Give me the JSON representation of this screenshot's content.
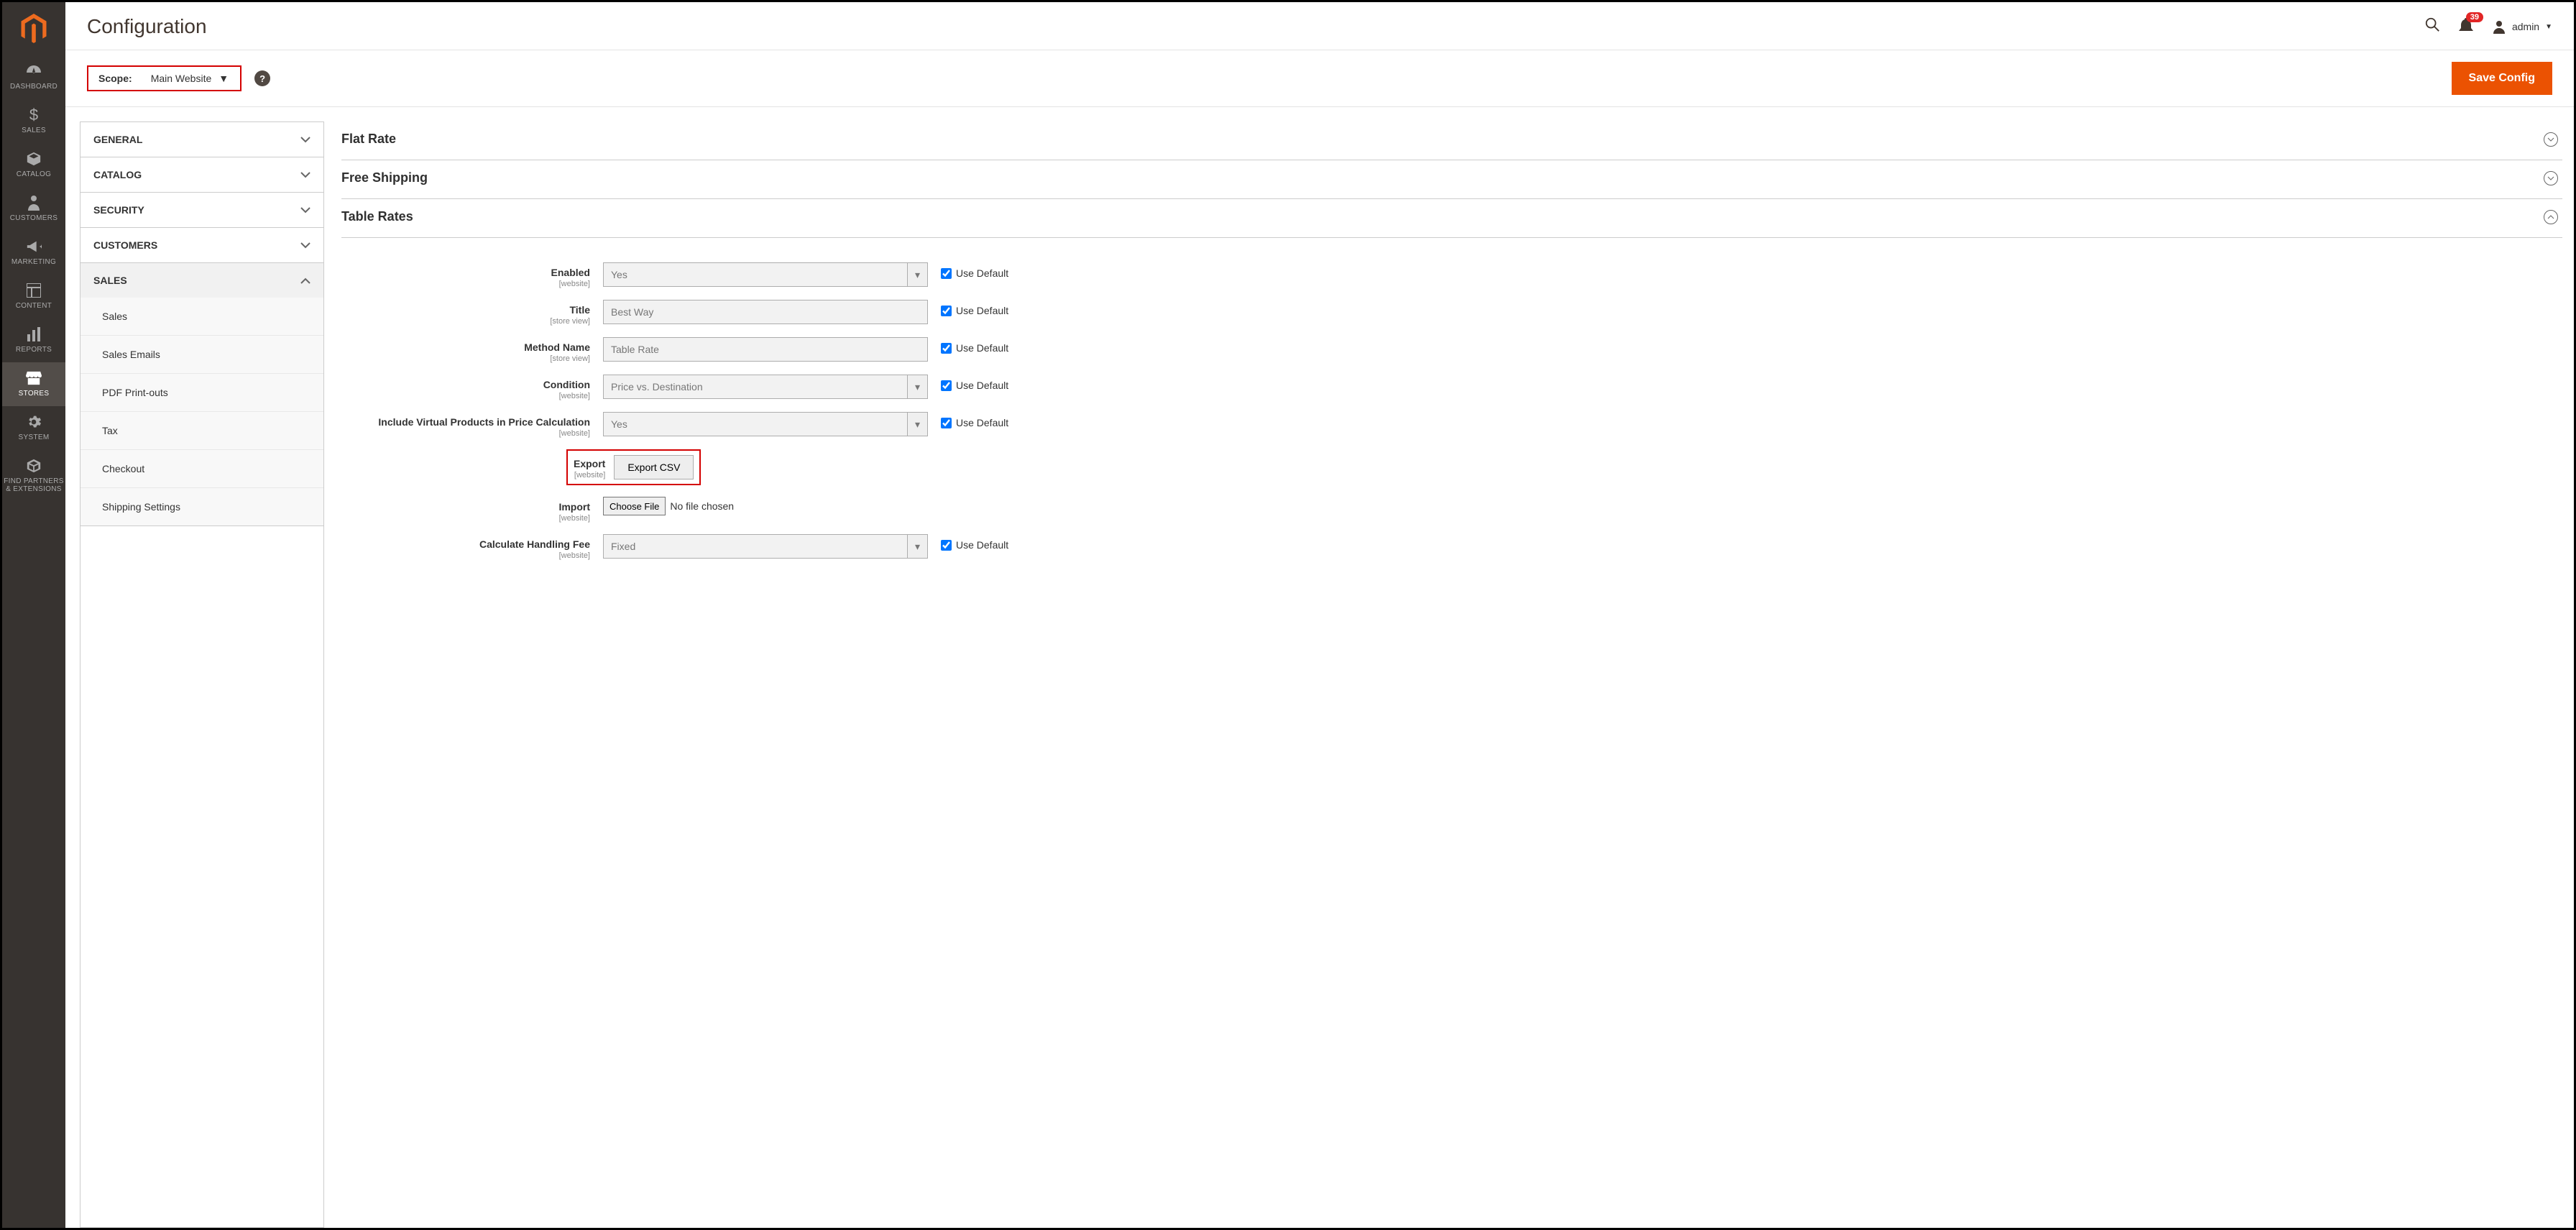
{
  "sidebar": {
    "items": [
      {
        "label": "DASHBOARD"
      },
      {
        "label": "SALES"
      },
      {
        "label": "CATALOG"
      },
      {
        "label": "CUSTOMERS"
      },
      {
        "label": "MARKETING"
      },
      {
        "label": "CONTENT"
      },
      {
        "label": "REPORTS"
      },
      {
        "label": "STORES"
      },
      {
        "label": "SYSTEM"
      },
      {
        "label": "FIND PARTNERS & EXTENSIONS"
      }
    ]
  },
  "header": {
    "title": "Configuration",
    "notif_count": "39",
    "user_name": "admin"
  },
  "toolbar": {
    "scope_label": "Scope:",
    "scope_value": "Main Website",
    "save_label": "Save Config"
  },
  "config_nav": {
    "groups": [
      {
        "label": "GENERAL",
        "expanded": false
      },
      {
        "label": "CATALOG",
        "expanded": false
      },
      {
        "label": "SECURITY",
        "expanded": false
      },
      {
        "label": "CUSTOMERS",
        "expanded": false
      },
      {
        "label": "SALES",
        "expanded": true,
        "children": [
          "Sales",
          "Sales Emails",
          "PDF Print-outs",
          "Tax",
          "Checkout",
          "Shipping Settings"
        ]
      }
    ]
  },
  "sections": {
    "flat_rate": "Flat Rate",
    "free_shipping": "Free Shipping",
    "table_rates": "Table Rates"
  },
  "use_default": "Use Default",
  "fields": {
    "enabled": {
      "label": "Enabled",
      "scope": "[website]",
      "value": "Yes"
    },
    "title": {
      "label": "Title",
      "scope": "[store view]",
      "value": "Best Way"
    },
    "method": {
      "label": "Method Name",
      "scope": "[store view]",
      "value": "Table Rate"
    },
    "condition": {
      "label": "Condition",
      "scope": "[website]",
      "value": "Price vs. Destination"
    },
    "virtual": {
      "label": "Include Virtual Products in Price Calculation",
      "scope": "[website]",
      "value": "Yes"
    },
    "export": {
      "label": "Export",
      "scope": "[website]",
      "button": "Export CSV"
    },
    "import": {
      "label": "Import",
      "scope": "[website]",
      "button": "Choose File",
      "file_text": "No file chosen"
    },
    "handling": {
      "label": "Calculate Handling Fee",
      "scope": "[website]",
      "value": "Fixed"
    }
  }
}
